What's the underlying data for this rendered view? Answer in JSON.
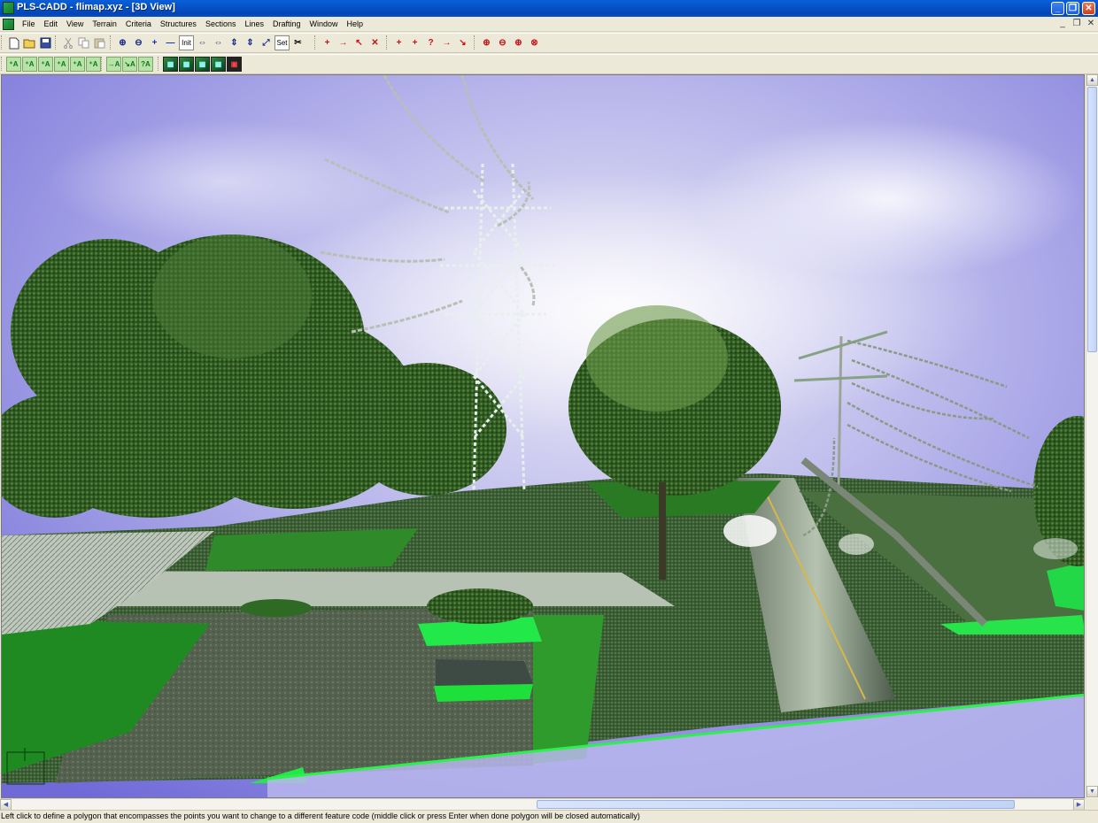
{
  "window": {
    "title": "PLS-CADD - flimap.xyz - [3D View]",
    "minimize_glyph": "_",
    "maximize_glyph": "❐",
    "close_glyph": "✕"
  },
  "menu": {
    "items": [
      "File",
      "Edit",
      "View",
      "Terrain",
      "Criteria",
      "Structures",
      "Sections",
      "Lines",
      "Drafting",
      "Window",
      "Help"
    ],
    "mdi_minimize_glyph": "_",
    "mdi_restore_glyph": "❐",
    "mdi_close_glyph": "✕"
  },
  "toolbar1": {
    "file_group": [
      "new-icon",
      "open-icon",
      "save-icon"
    ],
    "edit_group": [
      "cut-icon",
      "copy-icon",
      "paste-icon"
    ],
    "view_group_glyphs": [
      "⊕",
      "⊖",
      "+",
      "—",
      "Init",
      "⇔",
      "⇔",
      "⇕",
      "⇕",
      "⤢",
      "Set",
      "✂"
    ],
    "init_label": "Init",
    "set_label": "Set",
    "tools_a_glyphs": [
      "+",
      "→",
      "↖",
      "✕"
    ],
    "tools_b_glyphs": [
      "+",
      "+",
      "?",
      "→",
      "↘"
    ],
    "tools_c_glyphs": [
      "⊕",
      "⊖",
      "⊕",
      "⊗"
    ]
  },
  "toolbar2": {
    "terrain_group_glyphs": [
      "⁺A",
      "⁺A",
      "⁺A",
      "⁺A",
      "⁺A",
      "⁺A"
    ],
    "feature_group_glyphs": [
      "→A",
      "↘A",
      "?A"
    ],
    "render_group_count": 5
  },
  "status": {
    "text": "Left click to define a polygon that encompasses the points you want to change to a different feature code (middle click or press Enter when done polygon will be closed automatically)"
  },
  "colors": {
    "titlebar": "#0453c8",
    "sky": "#8c89e0",
    "foliage": "#3a6a2a",
    "terrain_highlight": "#22e84a",
    "tower": "#e8f0ee"
  }
}
